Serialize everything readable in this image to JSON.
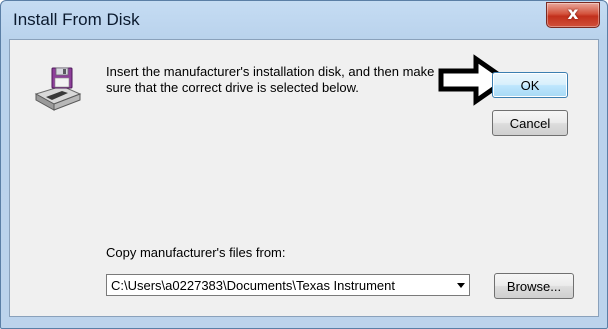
{
  "window": {
    "title": "Install From Disk",
    "close_glyph": "x",
    "close_icon": "close-icon"
  },
  "dialog": {
    "message": "Insert the manufacturer's installation disk, and then make sure that the correct drive is selected below.",
    "icon": "floppy-disk-drive-icon",
    "annotation_icon": "arrow-right-icon",
    "ok_label": "OK",
    "cancel_label": "Cancel",
    "copy_label": "Copy manufacturer's files from:",
    "path_value": "C:\\Users\\a0227383\\Documents\\Texas Instrument",
    "browse_label": "Browse..."
  },
  "colors": {
    "title_bar": "#bcd3ec",
    "client_bg": "#f0f0f0",
    "close_red": "#c2301c",
    "ok_border": "#3c7fb1"
  }
}
